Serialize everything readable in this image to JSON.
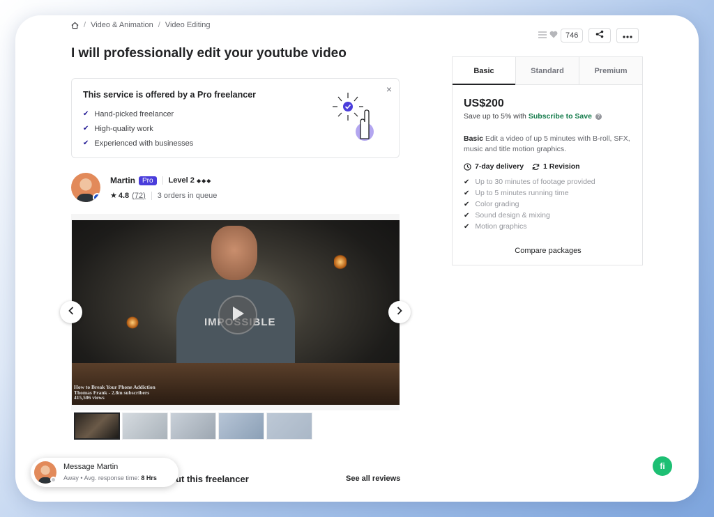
{
  "breadcrumb": {
    "items": [
      "Video & Animation",
      "Video Editing"
    ]
  },
  "gig": {
    "title": "I will professionally edit your youtube video"
  },
  "actions": {
    "likes_count": "746"
  },
  "pro_notice": {
    "heading": "This service is offered by a Pro freelancer",
    "items": [
      "Hand-picked freelancer",
      "High-quality work",
      "Experienced with businesses"
    ],
    "close": "×"
  },
  "seller": {
    "name": "Martin",
    "pro_label": "Pro",
    "level": "Level 2",
    "level_dots": "◆◆◆",
    "rating": "4.8",
    "reviews": "(72)",
    "queue": "3 orders in queue"
  },
  "video": {
    "shirt_text": "IMPOSSIBLE",
    "caption_lines": [
      "How to Break Your Phone Addiction",
      "Thomas Frank - 2.8m subscribers",
      "415,506 views"
    ]
  },
  "about": {
    "title": "ut this freelancer",
    "see_all": "See all reviews"
  },
  "message": {
    "name": "Message Martin",
    "status": "Away",
    "response_label": "Avg. response time:",
    "response_time": "8 Hrs"
  },
  "packages": {
    "tabs": [
      "Basic",
      "Standard",
      "Premium"
    ],
    "price": "US$200",
    "save_text": "Save up to 5% with",
    "save_link": "Subscribe to Save",
    "desc_title": "Basic",
    "desc": "Edit a video of up 5 minutes with B-roll, SFX, music and title motion graphics.",
    "delivery": "7-day delivery",
    "revisions": "1 Revision",
    "features": [
      "Up to 30 minutes of footage provided",
      "Up to 5 minutes running time",
      "Color grading",
      "Sound design & mixing",
      "Motion graphics"
    ],
    "compare": "Compare packages"
  },
  "badge": {
    "label": "fi"
  }
}
